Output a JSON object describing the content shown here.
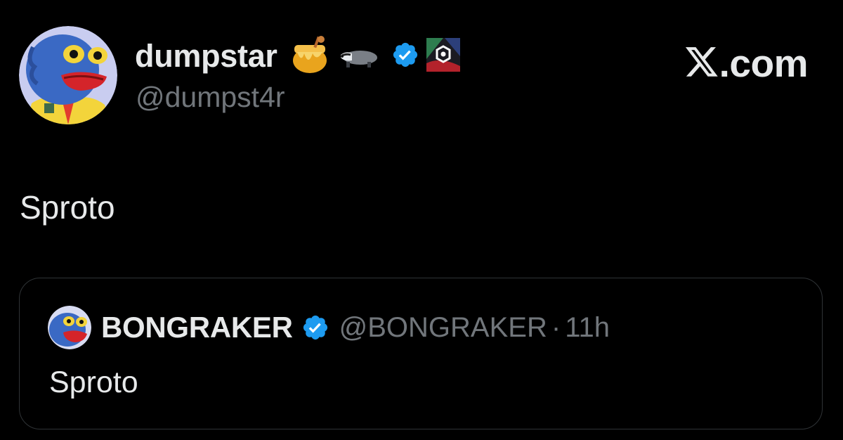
{
  "author": {
    "display_name": "dumpstar",
    "handle": "@dumpst4r",
    "avatar": "pepe-frog-avatar",
    "badges": [
      "honey-pot-icon",
      "badger-icon",
      "verified-badge-icon",
      "project-logo-icon"
    ]
  },
  "site": {
    "label": ".com",
    "logo": "x-logo"
  },
  "tweet": {
    "text": "Sproto"
  },
  "quoted_tweet": {
    "display_name": "BONGRAKER",
    "handle": "@BONGRAKER",
    "separator": "·",
    "time": "11h",
    "text": "Sproto",
    "avatar": "blue-pepe-avatar",
    "badges": [
      "verified-badge-icon"
    ]
  },
  "colors": {
    "background": "#000000",
    "text_primary": "#e7e9ea",
    "text_secondary": "#71767b",
    "verified": "#1d9bf0",
    "card_border": "#2f3336"
  }
}
